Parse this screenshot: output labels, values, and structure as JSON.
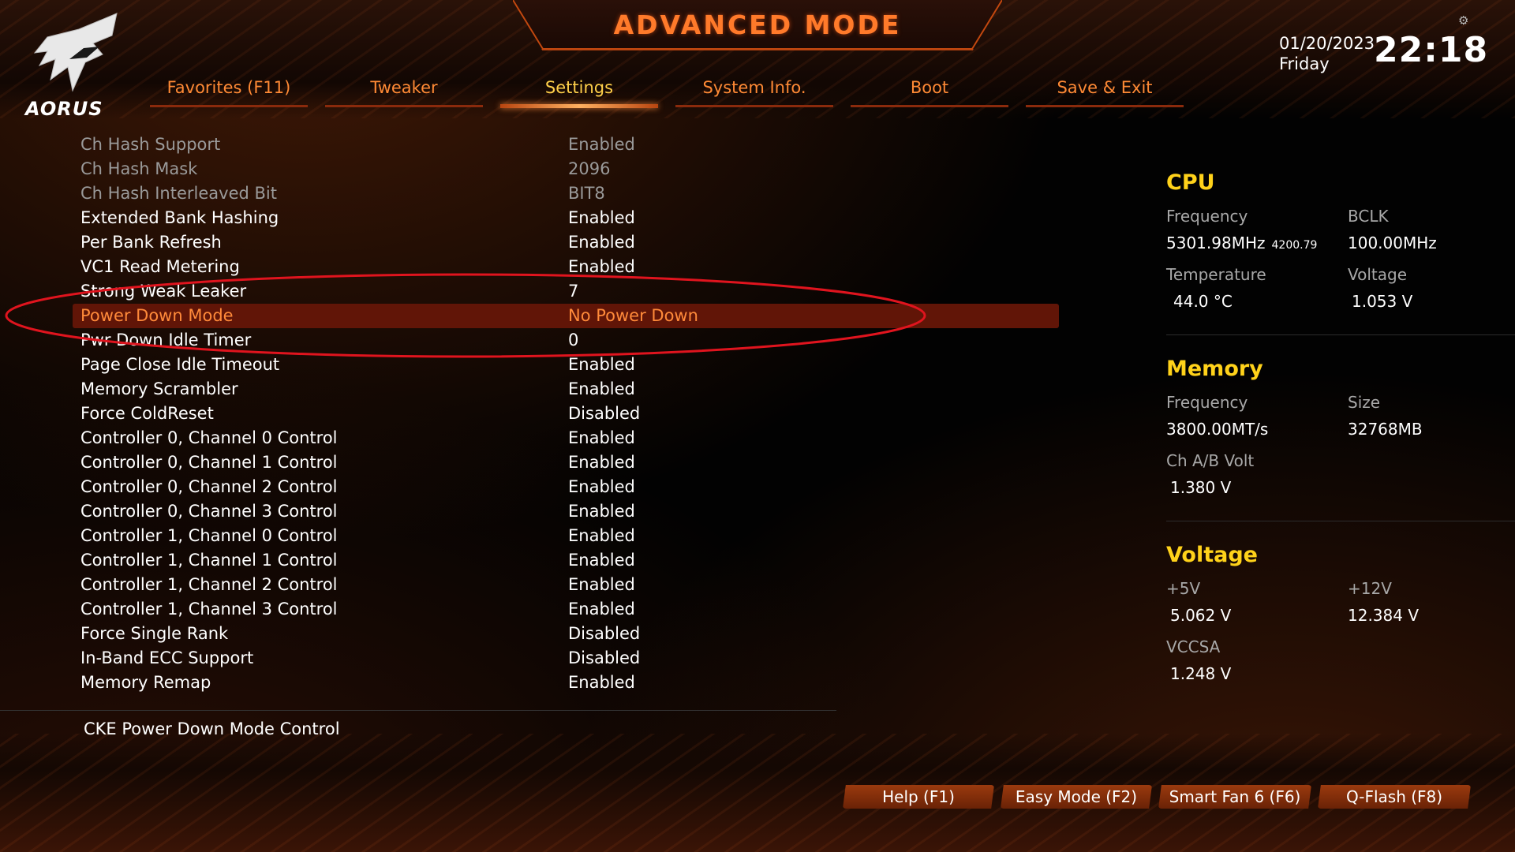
{
  "header": {
    "brand": "AORUS",
    "title": "ADVANCED MODE",
    "date": "01/20/2023",
    "day": "Friday",
    "time": "22:18"
  },
  "tabs": [
    {
      "label": "Favorites (F11)"
    },
    {
      "label": "Tweaker"
    },
    {
      "label": "Settings",
      "active": true
    },
    {
      "label": "System Info."
    },
    {
      "label": "Boot"
    },
    {
      "label": "Save & Exit"
    }
  ],
  "settings": [
    {
      "label": "Ch Hash Support",
      "value": "Enabled"
    },
    {
      "label": "Ch Hash Mask",
      "value": "2096"
    },
    {
      "label": "Ch Hash Interleaved Bit",
      "value": "BIT8"
    },
    {
      "label": "Extended Bank Hashing",
      "value": "Enabled"
    },
    {
      "label": "Per Bank Refresh",
      "value": "Enabled"
    },
    {
      "label": "VC1 Read Metering",
      "value": "Enabled"
    },
    {
      "label": "Strong Weak Leaker",
      "value": "7"
    },
    {
      "label": "Power Down Mode",
      "value": "No Power Down"
    },
    {
      "label": "Pwr Down Idle Timer",
      "value": "0"
    },
    {
      "label": "Page Close Idle Timeout",
      "value": "Enabled"
    },
    {
      "label": "Memory Scrambler",
      "value": "Enabled"
    },
    {
      "label": "Force ColdReset",
      "value": "Disabled"
    },
    {
      "label": "Controller 0, Channel 0 Control",
      "value": "Enabled"
    },
    {
      "label": "Controller 0, Channel 1 Control",
      "value": "Enabled"
    },
    {
      "label": "Controller 0, Channel 2 Control",
      "value": "Enabled"
    },
    {
      "label": "Controller 0, Channel 3 Control",
      "value": "Enabled"
    },
    {
      "label": "Controller 1, Channel 0 Control",
      "value": "Enabled"
    },
    {
      "label": "Controller 1, Channel 1 Control",
      "value": "Enabled"
    },
    {
      "label": "Controller 1, Channel 2 Control",
      "value": "Enabled"
    },
    {
      "label": "Controller 1, Channel 3 Control",
      "value": "Enabled"
    },
    {
      "label": "Force Single Rank",
      "value": "Disabled"
    },
    {
      "label": "In-Band ECC Support",
      "value": "Disabled"
    },
    {
      "label": "Memory Remap",
      "value": "Enabled"
    }
  ],
  "help_text": "CKE Power Down Mode Control",
  "cpu": {
    "title": "CPU",
    "frequency_label": "Frequency",
    "frequency": "5301.98MHz",
    "frequency_sub": "4200.79",
    "bclk_label": "BCLK",
    "bclk": "100.00MHz",
    "temperature_label": "Temperature",
    "temperature": "44.0 °C",
    "voltage_label": "Voltage",
    "voltage": "1.053 V"
  },
  "memory": {
    "title": "Memory",
    "frequency_label": "Frequency",
    "frequency": "3800.00MT/s",
    "size_label": "Size",
    "size": "32768MB",
    "volt_label": "Ch A/B Volt",
    "volt": "1.380 V"
  },
  "voltage": {
    "title": "Voltage",
    "v5_label": "+5V",
    "v5": "5.062 V",
    "v12_label": "+12V",
    "v12": "12.384 V",
    "vccsa_label": "VCCSA",
    "vccsa": "1.248 V"
  },
  "buttons": [
    {
      "label": "Help (F1)"
    },
    {
      "label": "Easy Mode (F2)"
    },
    {
      "label": "Smart Fan 6 (F6)"
    },
    {
      "label": "Q-Flash (F8)"
    }
  ],
  "colors": {
    "accent_orange": "#ff8a35",
    "active_tab": "#ffd04a",
    "section_title": "#ffd21a",
    "selected_row": "#611507",
    "annotation": "#e0141e"
  }
}
